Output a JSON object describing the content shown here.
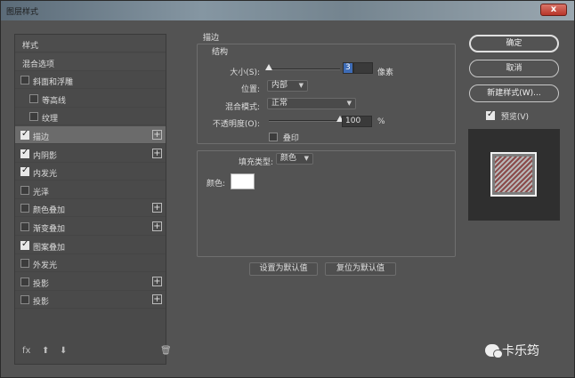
{
  "window": {
    "title": "图层样式",
    "close_label": "x"
  },
  "styles_panel": {
    "items": [
      {
        "label": "样式",
        "has_checkbox": false,
        "checked": false,
        "has_plus": false,
        "header": true
      },
      {
        "label": "混合选项",
        "has_checkbox": false,
        "checked": false,
        "has_plus": false,
        "header": true
      },
      {
        "label": "斜面和浮雕",
        "has_checkbox": true,
        "checked": false,
        "has_plus": false
      },
      {
        "label": "等高线",
        "has_checkbox": true,
        "checked": false,
        "has_plus": false,
        "indent": true
      },
      {
        "label": "纹理",
        "has_checkbox": true,
        "checked": false,
        "has_plus": false,
        "indent": true
      },
      {
        "label": "描边",
        "has_checkbox": true,
        "checked": true,
        "has_plus": true,
        "selected": true
      },
      {
        "label": "内阴影",
        "has_checkbox": true,
        "checked": true,
        "has_plus": true
      },
      {
        "label": "内发光",
        "has_checkbox": true,
        "checked": true,
        "has_plus": false
      },
      {
        "label": "光泽",
        "has_checkbox": true,
        "checked": false,
        "has_plus": false
      },
      {
        "label": "颜色叠加",
        "has_checkbox": true,
        "checked": false,
        "has_plus": true
      },
      {
        "label": "渐变叠加",
        "has_checkbox": true,
        "checked": false,
        "has_plus": true
      },
      {
        "label": "图案叠加",
        "has_checkbox": true,
        "checked": true,
        "has_plus": false
      },
      {
        "label": "外发光",
        "has_checkbox": true,
        "checked": false,
        "has_plus": false
      },
      {
        "label": "投影",
        "has_checkbox": true,
        "checked": false,
        "has_plus": true
      },
      {
        "label": "投影",
        "has_checkbox": true,
        "checked": false,
        "has_plus": true
      }
    ],
    "bottom": {
      "fx": "fx",
      "up": "⬆",
      "down": "⬇",
      "trash": "🗑"
    }
  },
  "stroke": {
    "section_title": "描边",
    "structure_title": "结构",
    "size_label": "大小(S):",
    "size_value": "3",
    "size_unit": "像素",
    "position_label": "位置:",
    "position_value": "内部",
    "blend_label": "混合模式:",
    "blend_value": "正常",
    "opacity_label": "不透明度(O):",
    "opacity_value": "100",
    "opacity_unit": "%",
    "opacity_level": 1.0,
    "size_level": 0.0,
    "emboss_label": "叠印",
    "fill_type_label": "填充类型:",
    "fill_type_value": "颜色",
    "color_label": "颜色:",
    "color_value": "#ffffff",
    "set_default_label": "设置为默认值",
    "reset_default_label": "复位为默认值"
  },
  "right_panel": {
    "ok_label": "确定",
    "cancel_label": "取消",
    "new_style_label": "新建样式(W)...",
    "preview_label": "预览(V)",
    "preview_checked": true
  },
  "watermark": {
    "text": "卡乐筠"
  },
  "colors": {
    "dialog_bg": "#535353",
    "selected_row": "#6b6b6b",
    "highlight": "#3e6cb6"
  }
}
